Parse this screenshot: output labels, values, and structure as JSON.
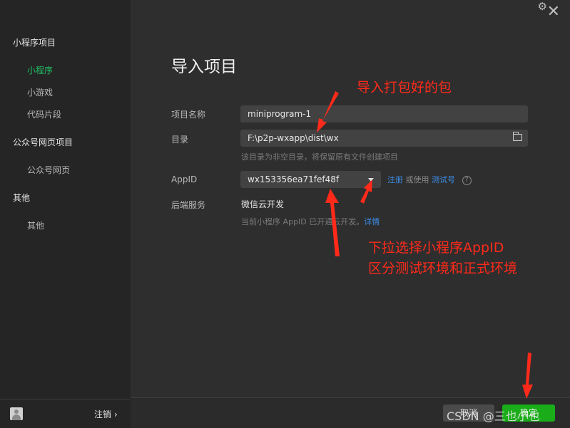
{
  "sidebar": {
    "sections": [
      {
        "title": "小程序项目",
        "items": [
          "小程序",
          "小游戏",
          "代码片段"
        ]
      },
      {
        "title": "公众号网页项目",
        "items": [
          "公众号网页"
        ]
      },
      {
        "title": "其他",
        "items": [
          "其他"
        ]
      }
    ],
    "active_item": "小程序",
    "logout_label": "注销",
    "logout_chevron": "›"
  },
  "header": {
    "settings_icon": "gear-icon",
    "close_icon": "close-icon"
  },
  "form": {
    "title": "导入项目",
    "project_name_label": "项目名称",
    "project_name_value": "miniprogram-1",
    "directory_label": "目录",
    "directory_value": "F:\\p2p-wxapp\\dist\\wx",
    "directory_hint": "该目录为非空目录，将保留原有文件创建项目",
    "appid_label": "AppID",
    "appid_value": "wx153356ea71fef48f",
    "register_link": "注册",
    "or_use_text": "或使用",
    "test_account_link": "测试号",
    "help_glyph": "?",
    "backend_label": "后端服务",
    "backend_value": "微信云开发",
    "backend_hint_prefix": "当前小程序 AppID 已开通云开发。",
    "backend_hint_link": "详情"
  },
  "footer": {
    "cancel_label": "取消",
    "confirm_label": "确定"
  },
  "annotations": {
    "import_note": "导入打包好的包",
    "appid_note_line1": "下拉选择小程序AppID",
    "appid_note_line2": "区分测试环境和正式环境",
    "watermark": "CSDN @三也小也"
  },
  "colors": {
    "accent_green": "#1fc264",
    "confirm_button": "#1aad19",
    "link_blue": "#3b8ee6",
    "annotation_red": "#ff2a1a"
  }
}
